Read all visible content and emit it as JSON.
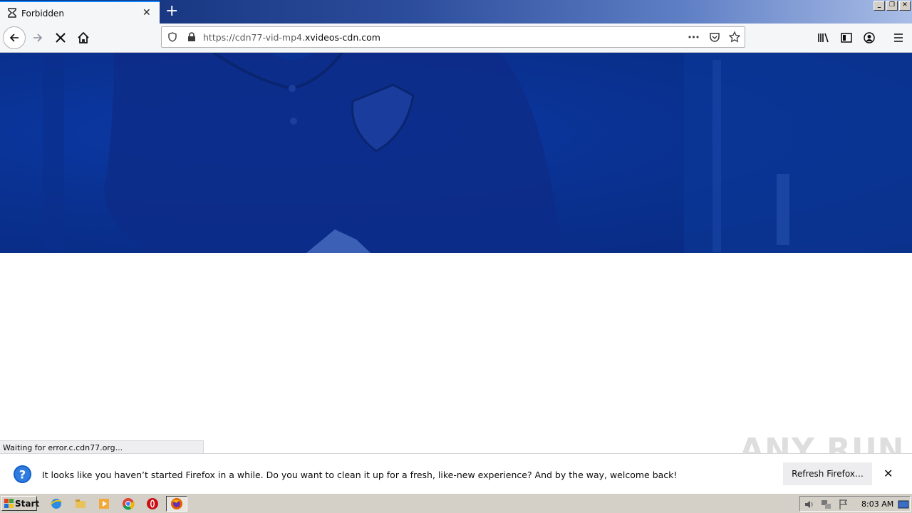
{
  "browser": {
    "tab_title": "Forbidden",
    "new_tab_symbol": "+",
    "url_prefix": "https://cdn77-vid-mp4.",
    "url_host": "xvideos-cdn.com",
    "page_actions_label": "•••"
  },
  "status": {
    "text": "Waiting for error.c.cdn77.org..."
  },
  "notification": {
    "message": "It looks like you haven’t started Firefox in a while. Do you want to clean it up for a fresh, like-new experience? And by the way, welcome back!",
    "button_label": "Refresh Firefox…",
    "close_symbol": "✕"
  },
  "watermark": {
    "text": "ANY RUN"
  },
  "taskbar": {
    "start_label": "Start",
    "clock": "8:03 AM"
  },
  "colors": {
    "accent": "#0a84ff",
    "hero": "#0a3293",
    "titlebar": "#0d2a73"
  }
}
